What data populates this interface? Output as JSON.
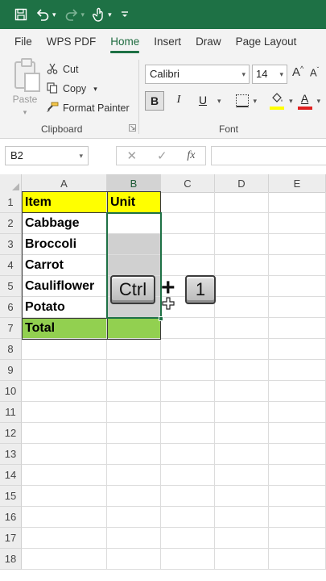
{
  "quick_access": {
    "save_icon": "save-icon",
    "undo_icon": "undo-icon",
    "redo_icon": "redo-icon",
    "touch_icon": "touch-mode-icon",
    "customize_icon": "customize-qat-icon"
  },
  "tabs": [
    "File",
    "WPS PDF",
    "Home",
    "Insert",
    "Draw",
    "Page Layout"
  ],
  "active_tab": "Home",
  "clipboard": {
    "paste_label": "Paste",
    "cut_label": "Cut",
    "copy_label": "Copy",
    "format_painter_label": "Format Painter",
    "group_label": "Clipboard"
  },
  "font": {
    "name": "Calibri",
    "size": "14",
    "bold_label": "B",
    "italic_label": "I",
    "underline_label": "U",
    "group_label": "Font",
    "grow_label": "A",
    "shrink_label": "A",
    "font_color_label": "A",
    "fill_color": "#ffff00",
    "font_color": "#e02020"
  },
  "formula_bar": {
    "name_box": "B2",
    "cancel_glyph": "✕",
    "enter_glyph": "✓",
    "fx_label": "fx",
    "formula": ""
  },
  "sheet": {
    "columns": [
      "A",
      "B",
      "C",
      "D",
      "E"
    ],
    "selected_column": "B",
    "rows": [
      "1",
      "2",
      "3",
      "4",
      "5",
      "6",
      "7",
      "8",
      "9",
      "10",
      "11",
      "12",
      "13",
      "14",
      "15",
      "16",
      "17",
      "18"
    ],
    "header": {
      "item": "Item",
      "unit": "Unit"
    },
    "items": [
      "Cabbage",
      "Broccoli",
      "Carrot",
      "Cauliflower",
      "Potato"
    ],
    "total_label": "Total",
    "header_fill": "#ffff00",
    "total_fill": "#92d050",
    "accent": "#1e7145"
  },
  "overlay": {
    "key1": "Ctrl",
    "plus": "+",
    "key2": "1"
  }
}
